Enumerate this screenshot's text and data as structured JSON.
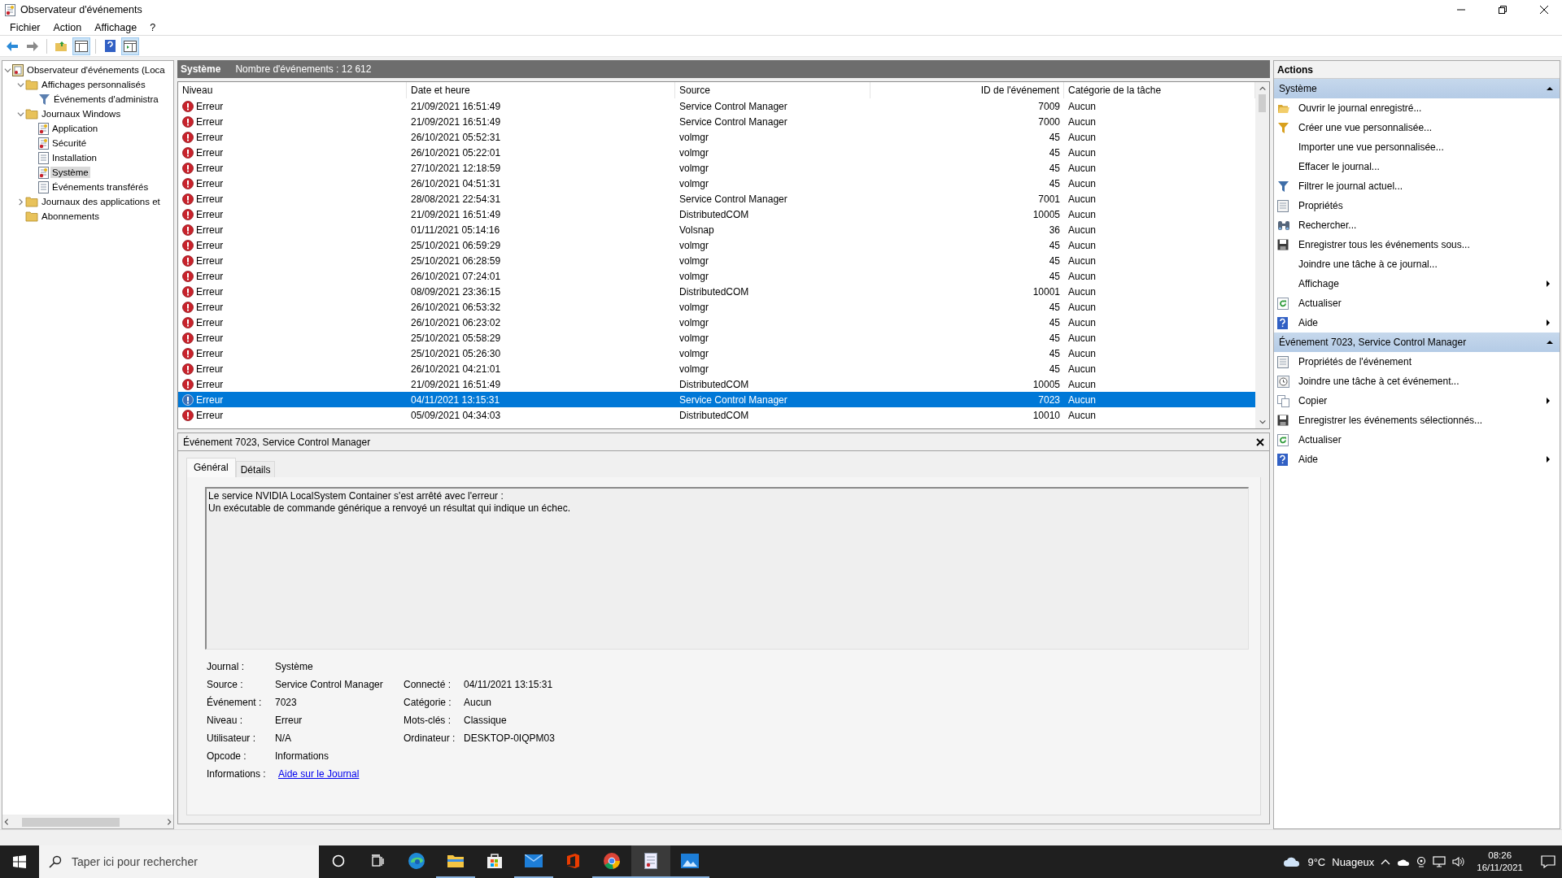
{
  "window": {
    "title": "Observateur d'événements"
  },
  "menu": [
    "Fichier",
    "Action",
    "Affichage",
    "?"
  ],
  "tree": [
    {
      "label": "Observateur d'événements (Loca",
      "expanded": true,
      "selected": false,
      "children": [
        {
          "label": "Affichages personnalisés",
          "kind": "folder",
          "expanded": true,
          "selected": false,
          "children": [
            {
              "label": "Événements d'administra",
              "kind": "filter",
              "selected": false
            }
          ]
        },
        {
          "label": "Journaux Windows",
          "kind": "folder",
          "expanded": true,
          "selected": false,
          "children": [
            {
              "label": "Application",
              "kind": "log",
              "selected": false
            },
            {
              "label": "Sécurité",
              "kind": "log",
              "selected": false
            },
            {
              "label": "Installation",
              "kind": "plain",
              "selected": false
            },
            {
              "label": "Système",
              "kind": "log",
              "selected": true
            },
            {
              "label": "Événements transférés",
              "kind": "plain",
              "selected": false
            }
          ]
        },
        {
          "label": "Journaux des applications et",
          "kind": "folder",
          "expanded": false,
          "selected": false
        },
        {
          "label": "Abonnements",
          "kind": "folder",
          "selected": false
        }
      ]
    }
  ],
  "log_header": {
    "title": "Système",
    "count": "Nombre d'événements : 12 612"
  },
  "table": {
    "columns": [
      "Niveau",
      "Date et heure",
      "Source",
      "ID de l'événement",
      "Catégorie de la tâche"
    ],
    "rows": [
      {
        "level": "Erreur",
        "date": "21/09/2021 16:51:49",
        "source": "Service Control Manager",
        "id": "7009",
        "category": "Aucun",
        "selected": false
      },
      {
        "level": "Erreur",
        "date": "21/09/2021 16:51:49",
        "source": "Service Control Manager",
        "id": "7000",
        "category": "Aucun",
        "selected": false
      },
      {
        "level": "Erreur",
        "date": "26/10/2021 05:52:31",
        "source": "volmgr",
        "id": "45",
        "category": "Aucun",
        "selected": false
      },
      {
        "level": "Erreur",
        "date": "26/10/2021 05:22:01",
        "source": "volmgr",
        "id": "45",
        "category": "Aucun",
        "selected": false
      },
      {
        "level": "Erreur",
        "date": "27/10/2021 12:18:59",
        "source": "volmgr",
        "id": "45",
        "category": "Aucun",
        "selected": false
      },
      {
        "level": "Erreur",
        "date": "26/10/2021 04:51:31",
        "source": "volmgr",
        "id": "45",
        "category": "Aucun",
        "selected": false
      },
      {
        "level": "Erreur",
        "date": "28/08/2021 22:54:31",
        "source": "Service Control Manager",
        "id": "7001",
        "category": "Aucun",
        "selected": false
      },
      {
        "level": "Erreur",
        "date": "21/09/2021 16:51:49",
        "source": "DistributedCOM",
        "id": "10005",
        "category": "Aucun",
        "selected": false
      },
      {
        "level": "Erreur",
        "date": "01/11/2021 05:14:16",
        "source": "Volsnap",
        "id": "36",
        "category": "Aucun",
        "selected": false
      },
      {
        "level": "Erreur",
        "date": "25/10/2021 06:59:29",
        "source": "volmgr",
        "id": "45",
        "category": "Aucun",
        "selected": false
      },
      {
        "level": "Erreur",
        "date": "25/10/2021 06:28:59",
        "source": "volmgr",
        "id": "45",
        "category": "Aucun",
        "selected": false
      },
      {
        "level": "Erreur",
        "date": "26/10/2021 07:24:01",
        "source": "volmgr",
        "id": "45",
        "category": "Aucun",
        "selected": false
      },
      {
        "level": "Erreur",
        "date": "08/09/2021 23:36:15",
        "source": "DistributedCOM",
        "id": "10001",
        "category": "Aucun",
        "selected": false
      },
      {
        "level": "Erreur",
        "date": "26/10/2021 06:53:32",
        "source": "volmgr",
        "id": "45",
        "category": "Aucun",
        "selected": false
      },
      {
        "level": "Erreur",
        "date": "26/10/2021 06:23:02",
        "source": "volmgr",
        "id": "45",
        "category": "Aucun",
        "selected": false
      },
      {
        "level": "Erreur",
        "date": "25/10/2021 05:58:29",
        "source": "volmgr",
        "id": "45",
        "category": "Aucun",
        "selected": false
      },
      {
        "level": "Erreur",
        "date": "25/10/2021 05:26:30",
        "source": "volmgr",
        "id": "45",
        "category": "Aucun",
        "selected": false
      },
      {
        "level": "Erreur",
        "date": "26/10/2021 04:21:01",
        "source": "volmgr",
        "id": "45",
        "category": "Aucun",
        "selected": false
      },
      {
        "level": "Erreur",
        "date": "21/09/2021 16:51:49",
        "source": "DistributedCOM",
        "id": "10005",
        "category": "Aucun",
        "selected": false
      },
      {
        "level": "Erreur",
        "date": "04/11/2021 13:15:31",
        "source": "Service Control Manager",
        "id": "7023",
        "category": "Aucun",
        "selected": true
      },
      {
        "level": "Erreur",
        "date": "05/09/2021 04:34:03",
        "source": "DistributedCOM",
        "id": "10010",
        "category": "Aucun",
        "selected": false
      }
    ]
  },
  "detail": {
    "title": "Événement 7023, Service Control Manager",
    "tabs": [
      {
        "label": "Général",
        "selected": true
      },
      {
        "label": "Détails",
        "selected": false
      }
    ],
    "message": [
      "Le service NVIDIA LocalSystem Container s'est arrêté avec l'erreur :",
      "Un exécutable de commande générique a renvoyé un résultat qui indique un échec."
    ],
    "fields": [
      [
        {
          "label": "Journal :",
          "value": "Système"
        }
      ],
      [
        {
          "label": "Source :",
          "value": "Service Control Manager"
        },
        {
          "label": "Connecté :",
          "value": "04/11/2021 13:15:31"
        }
      ],
      [
        {
          "label": "Événement :",
          "value": "7023"
        },
        {
          "label": "Catégorie :",
          "value": "Aucun"
        }
      ],
      [
        {
          "label": "Niveau :",
          "value": "Erreur"
        },
        {
          "label": "Mots-clés :",
          "value": "Classique"
        }
      ],
      [
        {
          "label": "Utilisateur :",
          "value": "N/A"
        },
        {
          "label": "Ordinateur :",
          "value": "DESKTOP-0IQPM03"
        }
      ],
      [
        {
          "label": "Opcode :",
          "value": "Informations"
        }
      ],
      [
        {
          "label": "Informations :",
          "value": "Aide sur le Journal",
          "kind": "link"
        }
      ]
    ]
  },
  "actions": {
    "title": "Actions",
    "sections": [
      {
        "title": "Système",
        "expanded": true,
        "items": [
          {
            "label": "Ouvrir le journal enregistré...",
            "kind": "open",
            "submenu": false
          },
          {
            "label": "Créer une vue personnalisée...",
            "kind": "funnel",
            "submenu": false
          },
          {
            "label": "Importer une vue personnalisée...",
            "kind": "none",
            "submenu": false
          },
          {
            "label": "Effacer le journal...",
            "kind": "none",
            "submenu": false
          },
          {
            "label": "Filtrer le journal actuel...",
            "kind": "filter",
            "submenu": false
          },
          {
            "label": "Propriétés",
            "kind": "sheet",
            "submenu": false
          },
          {
            "label": "Rechercher...",
            "kind": "binoculars",
            "submenu": false
          },
          {
            "label": "Enregistrer tous les événements sous...",
            "kind": "disk",
            "submenu": false
          },
          {
            "label": "Joindre une tâche à ce journal...",
            "kind": "none",
            "submenu": false
          },
          {
            "label": "Affichage",
            "kind": "none",
            "submenu": true
          },
          {
            "label": "Actualiser",
            "kind": "refresh",
            "submenu": false
          },
          {
            "label": "Aide",
            "kind": "help",
            "submenu": true
          }
        ]
      },
      {
        "title": "Événement 7023, Service Control Manager",
        "expanded": true,
        "items": [
          {
            "label": "Propriétés de l'événement",
            "kind": "sheet",
            "submenu": false
          },
          {
            "label": "Joindre une tâche à cet événement...",
            "kind": "clock",
            "submenu": false
          },
          {
            "label": "Copier",
            "kind": "copy",
            "submenu": true
          },
          {
            "label": "Enregistrer les événements sélectionnés...",
            "kind": "disk",
            "submenu": false
          },
          {
            "label": "Actualiser",
            "kind": "refresh",
            "submenu": false
          },
          {
            "label": "Aide",
            "kind": "help",
            "submenu": true
          }
        ]
      }
    ]
  },
  "taskbar": {
    "search_placeholder": "Taper ici pour rechercher",
    "apps": [
      {
        "kind": "cortana",
        "active": false
      },
      {
        "kind": "taskview",
        "active": false
      },
      {
        "kind": "edge",
        "active": false
      },
      {
        "kind": "explorer",
        "active": true
      },
      {
        "kind": "store",
        "active": false
      },
      {
        "kind": "mail",
        "active": true
      },
      {
        "kind": "office",
        "active": false
      },
      {
        "kind": "chrome",
        "active": true
      },
      {
        "kind": "eventviewer",
        "active": true
      },
      {
        "kind": "photos",
        "active": true
      }
    ],
    "temperature": "9°C",
    "weather": "Nuageux",
    "time": "08:26",
    "date": "16/11/2021"
  }
}
